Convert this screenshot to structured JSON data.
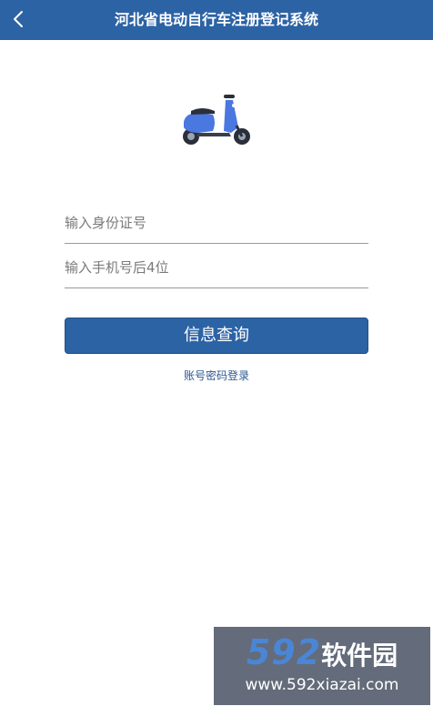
{
  "header": {
    "title": "河北省电动自行车注册登记系统",
    "back_icon": "chevron-left-icon",
    "background": "#2c63a5"
  },
  "logo": {
    "icon": "electric-scooter-icon",
    "color": "#4a78e0"
  },
  "form": {
    "id_placeholder": "输入身份证号",
    "phone_placeholder": "输入手机号后4位",
    "query_button_label": "信息查询",
    "account_login_link": "账号密码登录"
  },
  "watermark": {
    "brand_number": "592",
    "brand_text": "软件园",
    "url": "www.592xiazai.com"
  }
}
